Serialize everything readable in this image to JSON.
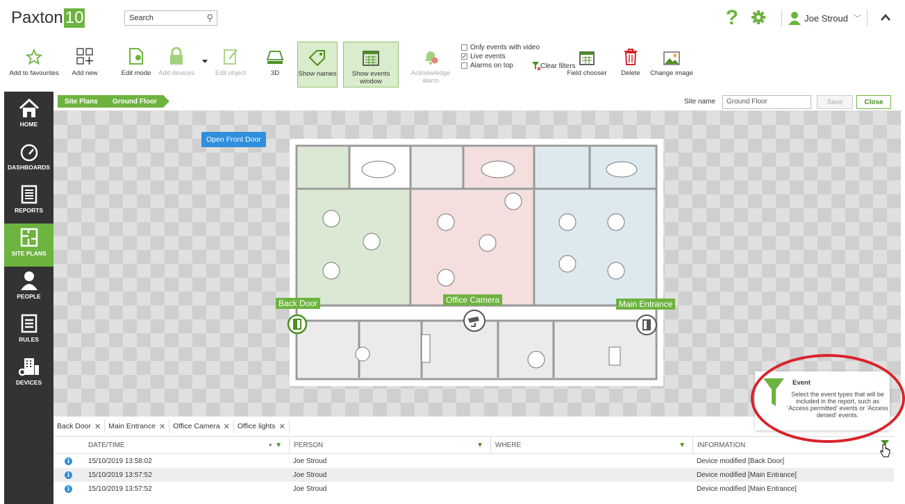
{
  "app": {
    "logo_text": "Paxton",
    "logo_num": "10"
  },
  "search": {
    "placeholder": "Search"
  },
  "user": {
    "name": "Joe Stroud"
  },
  "colors": {
    "brand_green": "#6db33f",
    "nav_bg": "#333333",
    "info_blue": "#2f8fdc",
    "highlight_red": "#d8232a"
  },
  "ribbon": {
    "add_favourites": "Add to favourites",
    "add_new": "Add new",
    "edit_mode": "Edit mode",
    "add_devices": "Add devices",
    "edit_object": "Edit object",
    "three_d": "3D",
    "show_names": "Show names",
    "show_events_window": "Show events window",
    "acknowledge_alarm": "Acknowledge alarm",
    "only_events_video": "Only events with video",
    "live_events": "Live events",
    "alarms_on_top": "Alarms on top",
    "clear_filters": "Clear filters",
    "field_chooser": "Field chooser",
    "delete": "Delete",
    "change_image": "Change image"
  },
  "nav": {
    "home": "HOME",
    "dashboards": "DASHBOARDS",
    "reports": "REPORTS",
    "site_plans": "SITE PLANS",
    "people": "PEOPLE",
    "rules": "RULES",
    "devices": "DEVICES"
  },
  "breadcrumb": {
    "root": "Site Plans",
    "current": "Ground Floor"
  },
  "site": {
    "name_label": "Site name",
    "name_value": "Ground Floor",
    "save": "Save",
    "close": "Close"
  },
  "canvas": {
    "open_front_door": "Open Front Door",
    "devices": {
      "back_door": "Back Door",
      "office_camera": "Office Camera",
      "main_entrance": "Main Entrance"
    }
  },
  "filters": [
    "Back Door",
    "Main Entrance",
    "Office Camera",
    "Office lights"
  ],
  "table": {
    "headers": {
      "datetime": "DATE/TIME",
      "person": "PERSON",
      "where": "WHERE",
      "information": "INFORMATION"
    },
    "rows": [
      {
        "datetime": "15/10/2019 13:58:02",
        "person": "Joe Stroud",
        "where": "",
        "information": "Device modified [Back Door]"
      },
      {
        "datetime": "15/10/2019 13:57:52",
        "person": "Joe Stroud",
        "where": "",
        "information": "Device modified [Main Entrance]"
      },
      {
        "datetime": "15/10/2019 13:57:52",
        "person": "Joe Stroud",
        "where": "",
        "information": "Device modified [Main Entrance]"
      }
    ]
  },
  "tooltip": {
    "title": "Event",
    "text": "Select the event types that will be included in the report, such as 'Access permitted' events or 'Access denied' events."
  }
}
